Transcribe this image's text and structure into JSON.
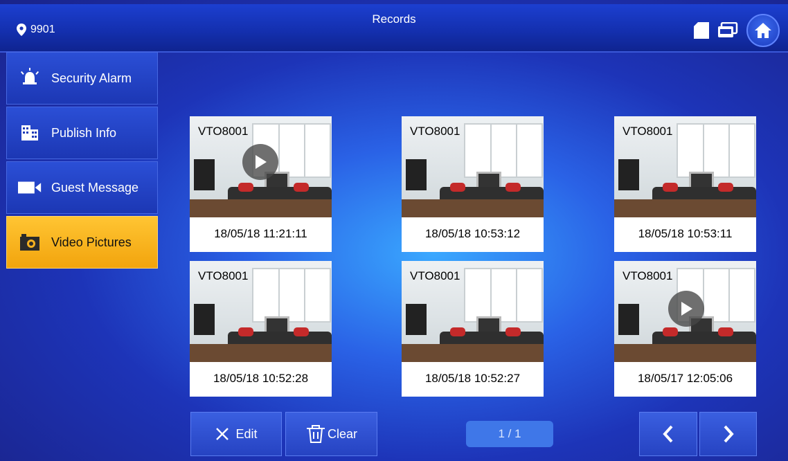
{
  "header": {
    "location": "9901",
    "title": "Records"
  },
  "sidebar": {
    "items": [
      {
        "label": "Security Alarm",
        "icon": "alarm-icon"
      },
      {
        "label": "Publish Info",
        "icon": "building-icon"
      },
      {
        "label": "Guest Message",
        "icon": "video-camera-icon"
      },
      {
        "label": "Video Pictures",
        "icon": "camera-icon",
        "active": true
      }
    ]
  },
  "records": [
    {
      "camera": "VTO8001",
      "timestamp": "18/05/18 11:21:11",
      "has_video": true
    },
    {
      "camera": "VTO8001",
      "timestamp": "18/05/18 10:53:12",
      "has_video": false
    },
    {
      "camera": "VTO8001",
      "timestamp": "18/05/18 10:53:11",
      "has_video": false
    },
    {
      "camera": "VTO8001",
      "timestamp": "18/05/18 10:52:28",
      "has_video": false
    },
    {
      "camera": "VTO8001",
      "timestamp": "18/05/18 10:52:27",
      "has_video": false
    },
    {
      "camera": "VTO8001",
      "timestamp": "18/05/17 12:05:06",
      "has_video": true
    }
  ],
  "toolbar": {
    "edit_label": "Edit",
    "clear_label": "Clear",
    "page_indicator": "1 / 1"
  },
  "colors": {
    "active_item": "#f5b120",
    "background": "#2a62e6"
  }
}
